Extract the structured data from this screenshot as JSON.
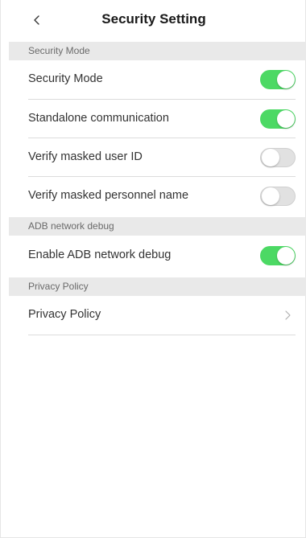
{
  "header": {
    "title": "Security Setting",
    "back_icon": "chevron-left-icon"
  },
  "sections": {
    "security_mode": {
      "header": "Security Mode",
      "items": [
        {
          "label": "Security Mode",
          "enabled": true
        },
        {
          "label": "Standalone communication",
          "enabled": true
        },
        {
          "label": "Verify masked user ID",
          "enabled": false
        },
        {
          "label": "Verify masked personnel name",
          "enabled": false
        }
      ]
    },
    "adb": {
      "header": "ADB network debug",
      "items": [
        {
          "label": "Enable ADB network debug",
          "enabled": true
        }
      ]
    },
    "privacy": {
      "header": "Privacy Policy",
      "items": [
        {
          "label": "Privacy Policy",
          "icon": "chevron-right-icon"
        }
      ]
    }
  },
  "colors": {
    "switch_on": "#4cd964",
    "switch_off": "#e1e1e1",
    "section_bg": "#e9e9e9"
  }
}
